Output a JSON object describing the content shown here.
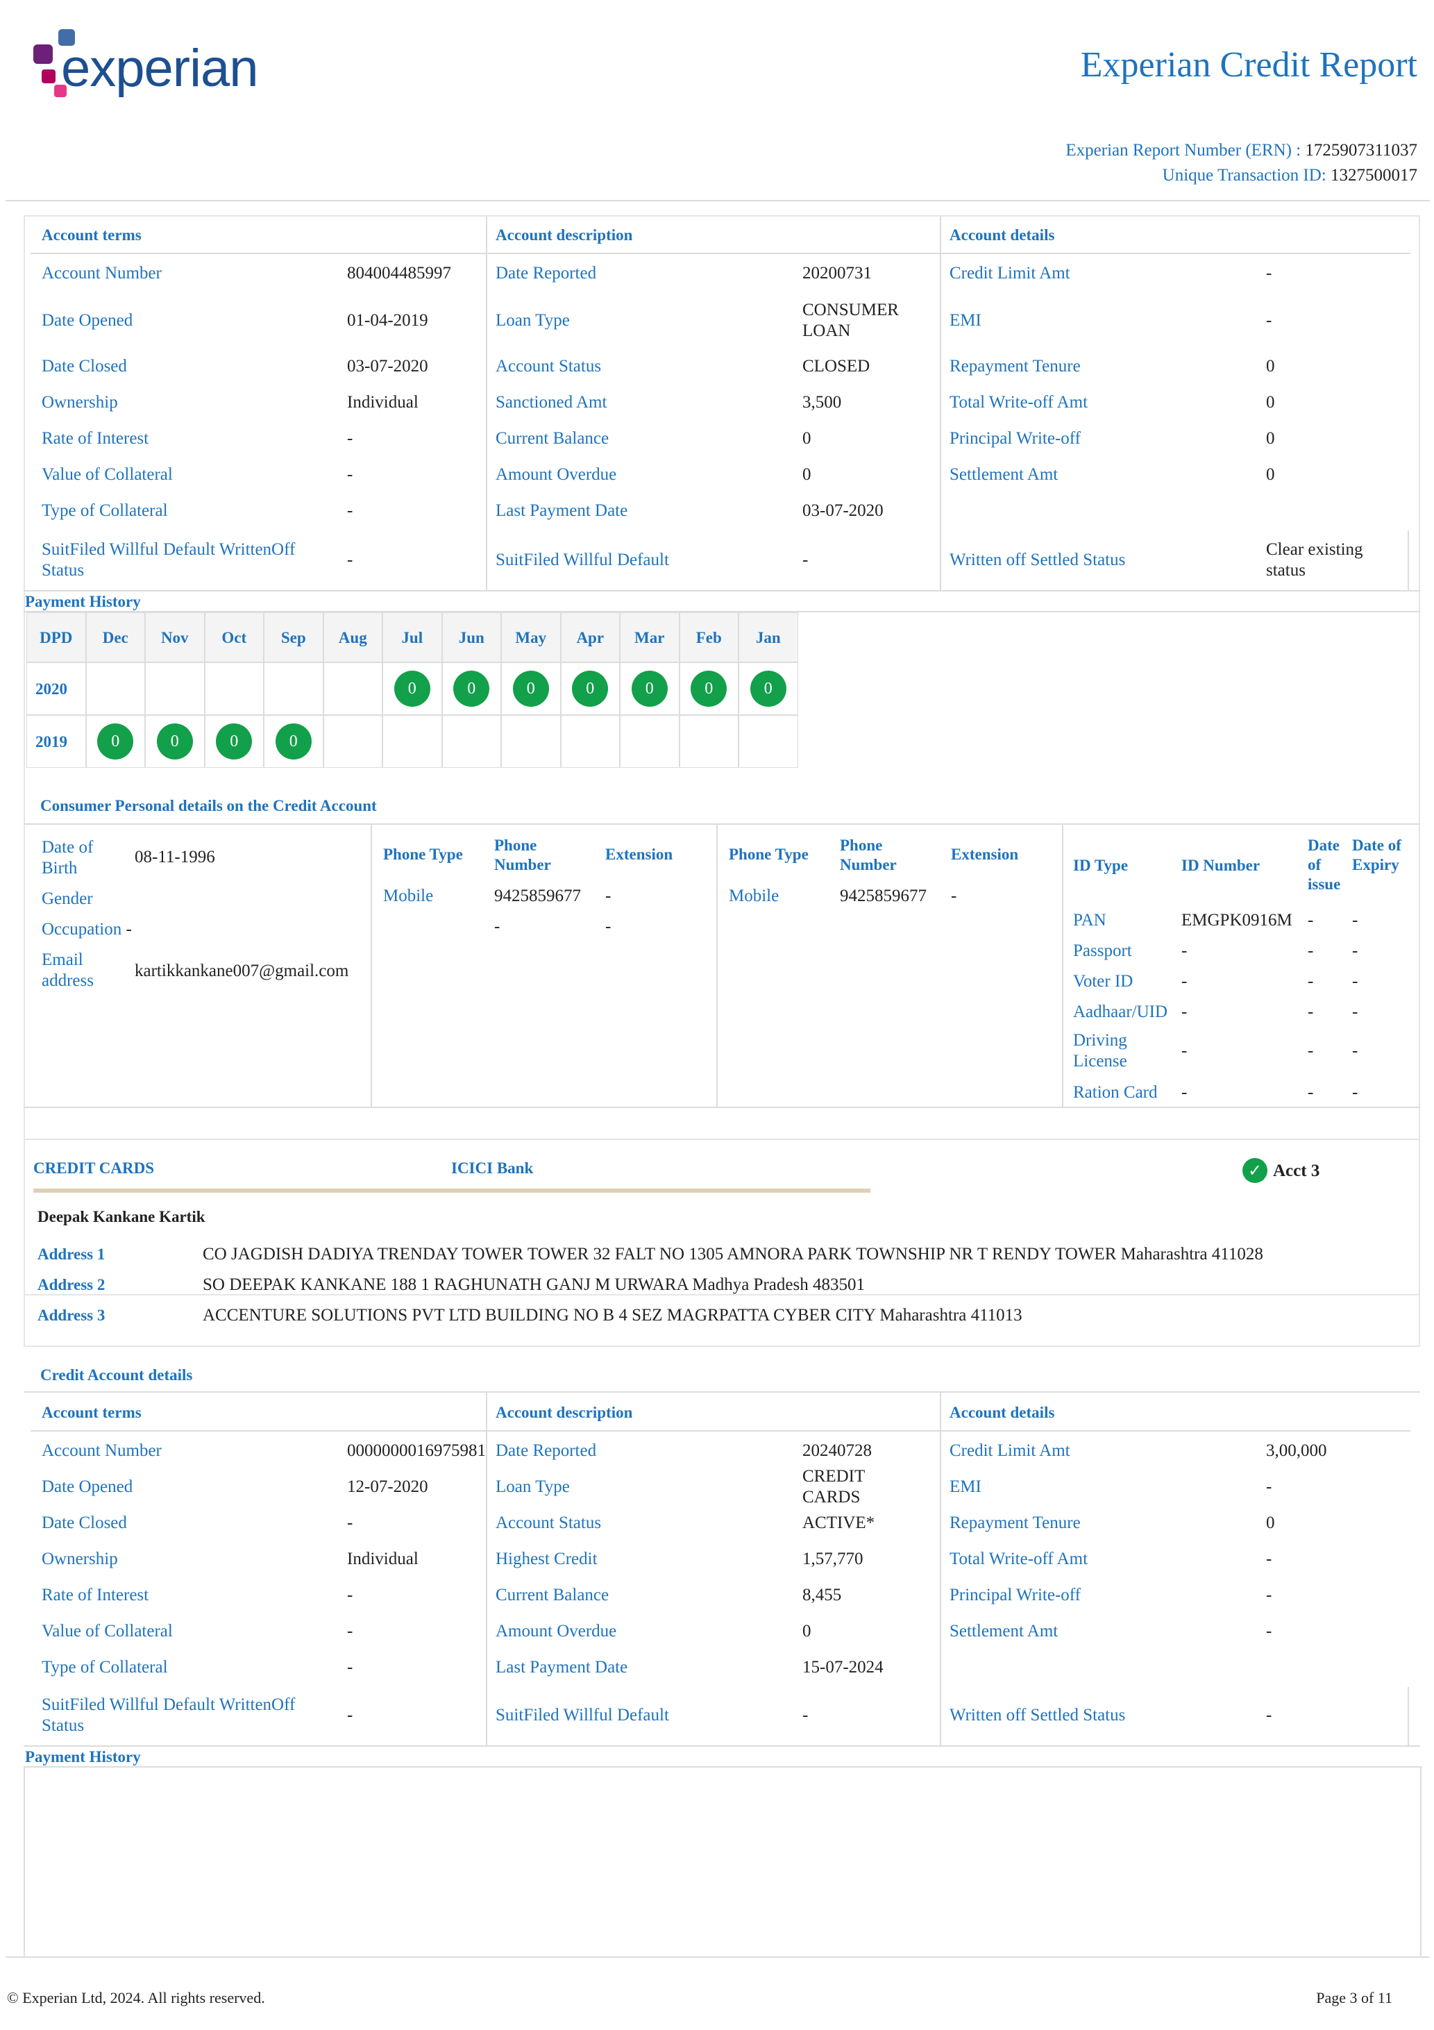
{
  "header": {
    "logo_text": "experian",
    "report_title": "Experian Credit Report",
    "ern_label": "Experian Report Number (ERN) :",
    "ern_value": "1725907311037",
    "utid_label": "Unique Transaction ID:",
    "utid_value": "1327500017"
  },
  "colors": {
    "blue": "#1e73be",
    "green": "#12a04a",
    "border": "#dcdcdc",
    "tan": "#e0cfb8"
  },
  "account1": {
    "col_headers": [
      "Account terms",
      "Account description",
      "Account details"
    ],
    "terms": [
      {
        "label": "Account Number",
        "value": "804004485997"
      },
      {
        "label": "Date Opened",
        "value": "01-04-2019"
      },
      {
        "label": "Date Closed",
        "value": "03-07-2020"
      },
      {
        "label": "Ownership",
        "value": "Individual"
      },
      {
        "label": "Rate of Interest",
        "value": "-"
      },
      {
        "label": "Value of Collateral",
        "value": "-"
      },
      {
        "label": "Type of Collateral",
        "value": "-"
      },
      {
        "label": "SuitFiled Willful Default WrittenOff Status",
        "value": "-"
      }
    ],
    "description": [
      {
        "label": "Date Reported",
        "value": "20200731"
      },
      {
        "label": "Loan Type",
        "value": "CONSUMER LOAN"
      },
      {
        "label": "Account Status",
        "value": "CLOSED"
      },
      {
        "label": "Sanctioned Amt",
        "value": "3,500"
      },
      {
        "label": "Current Balance",
        "value": "0"
      },
      {
        "label": "Amount Overdue",
        "value": "0"
      },
      {
        "label": "Last Payment Date",
        "value": "03-07-2020"
      },
      {
        "label": "SuitFiled Willful Default",
        "value": "-"
      }
    ],
    "details": [
      {
        "label": "Credit Limit Amt",
        "value": "-"
      },
      {
        "label": "EMI",
        "value": "-"
      },
      {
        "label": "Repayment Tenure",
        "value": "0"
      },
      {
        "label": "Total Write-off Amt",
        "value": "0"
      },
      {
        "label": "Principal Write-off",
        "value": "0"
      },
      {
        "label": "Settlement Amt",
        "value": "0"
      },
      {
        "label": "",
        "value": ""
      },
      {
        "label": "Written off Settled Status",
        "value": "Clear existing status"
      }
    ]
  },
  "payment_history": {
    "title": "Payment History",
    "headers": [
      "DPD",
      "Dec",
      "Nov",
      "Oct",
      "Sep",
      "Aug",
      "Jul",
      "Jun",
      "May",
      "Apr",
      "Mar",
      "Feb",
      "Jan"
    ],
    "rows": [
      {
        "year": "2020",
        "values": [
          "",
          "",
          "",
          "",
          "",
          "0",
          "0",
          "0",
          "0",
          "0",
          "0",
          "0"
        ]
      },
      {
        "year": "2019",
        "values": [
          "0",
          "0",
          "0",
          "0",
          "",
          "",
          "",
          "",
          "",
          "",
          "",
          ""
        ]
      }
    ]
  },
  "personal": {
    "title": "Consumer Personal details on the Credit Account",
    "dob_label": "Date of Birth",
    "dob_value": "08-11-1996",
    "gender_label": "Gender",
    "gender_value": "",
    "occupation_label": "Occupation",
    "occupation_value": "-",
    "email_label": "Email address",
    "email_value": "kartikkankane007@gmail.com",
    "phone_headers": [
      "Phone Type",
      "Phone Number",
      "Extension"
    ],
    "phones1": [
      {
        "type": "Mobile",
        "number": "9425859677",
        "ext": "-"
      },
      {
        "type": "",
        "number": "-",
        "ext": "-"
      }
    ],
    "phones2": [
      {
        "type": "Mobile",
        "number": "9425859677",
        "ext": "-"
      }
    ],
    "id_headers": [
      "ID Type",
      "ID Number",
      "Date of issue",
      "Date of Expiry"
    ],
    "ids": [
      {
        "type": "PAN",
        "number": "EMGPK0916M",
        "issue": "-",
        "expiry": "-"
      },
      {
        "type": "Passport",
        "number": "-",
        "issue": "-",
        "expiry": "-"
      },
      {
        "type": "Voter ID",
        "number": "-",
        "issue": "-",
        "expiry": "-"
      },
      {
        "type": "Aadhaar/UID",
        "number": "-",
        "issue": "-",
        "expiry": "-"
      },
      {
        "type": "Driving License",
        "number": "-",
        "issue": "-",
        "expiry": "-"
      },
      {
        "type": "Ration Card",
        "number": "-",
        "issue": "-",
        "expiry": "-"
      }
    ]
  },
  "account3": {
    "category": "CREDIT CARDS",
    "bank": "ICICI Bank",
    "acct_label": "Acct 3",
    "holder": "Deepak Kankane Kartik",
    "addresses": [
      {
        "label": "Address 1",
        "value": "CO JAGDISH DADIYA TRENDAY TOWER TOWER 32 FALT NO 1305 AMNORA PARK TOWNSHIP NR T RENDY TOWER Maharashtra 411028"
      },
      {
        "label": "Address 2",
        "value": "SO DEEPAK KANKANE 188 1 RAGHUNATH GANJ M URWARA Madhya Pradesh 483501"
      },
      {
        "label": "Address 3",
        "value": "ACCENTURE SOLUTIONS PVT LTD BUILDING NO B 4 SEZ MAGRPATTA CYBER CITY Maharashtra 411013"
      }
    ],
    "details_title": "Credit Account details",
    "col_headers": [
      "Account terms",
      "Account description",
      "Account details"
    ],
    "terms": [
      {
        "label": "Account Number",
        "value": "0000000016975981"
      },
      {
        "label": "Date Opened",
        "value": "12-07-2020"
      },
      {
        "label": "Date Closed",
        "value": "-"
      },
      {
        "label": "Ownership",
        "value": "Individual"
      },
      {
        "label": "Rate of Interest",
        "value": "-"
      },
      {
        "label": "Value of Collateral",
        "value": "-"
      },
      {
        "label": "Type of Collateral",
        "value": "-"
      },
      {
        "label": "SuitFiled Willful Default WrittenOff Status",
        "value": "-"
      }
    ],
    "description": [
      {
        "label": "Date Reported",
        "value": "20240728"
      },
      {
        "label": "Loan Type",
        "value": "CREDIT CARDS"
      },
      {
        "label": "Account Status",
        "value": "ACTIVE*"
      },
      {
        "label": "Highest Credit",
        "value": "1,57,770"
      },
      {
        "label": "Current Balance",
        "value": "8,455"
      },
      {
        "label": "Amount Overdue",
        "value": "0"
      },
      {
        "label": "Last Payment Date",
        "value": "15-07-2024"
      },
      {
        "label": "SuitFiled Willful Default",
        "value": "-"
      }
    ],
    "details": [
      {
        "label": "Credit Limit Amt",
        "value": "3,00,000"
      },
      {
        "label": "EMI",
        "value": "-"
      },
      {
        "label": "Repayment Tenure",
        "value": "0"
      },
      {
        "label": "Total Write-off Amt",
        "value": "-"
      },
      {
        "label": "Principal Write-off",
        "value": "-"
      },
      {
        "label": "Settlement Amt",
        "value": "-"
      },
      {
        "label": "",
        "value": ""
      },
      {
        "label": "Written off Settled Status",
        "value": "-"
      }
    ],
    "payment_history_title": "Payment History"
  },
  "footer": {
    "copyright": "© Experian Ltd, 2024. All rights reserved.",
    "page": "Page 3 of 11"
  }
}
